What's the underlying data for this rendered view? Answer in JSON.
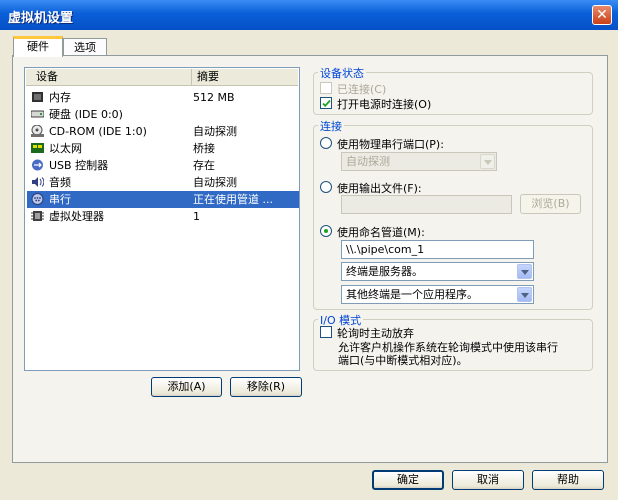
{
  "window": {
    "title": "虚拟机设置",
    "close_glyph": "✕"
  },
  "tabs": [
    {
      "label": "硬件",
      "active": true
    },
    {
      "label": "选项",
      "active": false
    }
  ],
  "device_list": {
    "columns": [
      "设备",
      "摘要"
    ],
    "rows": [
      {
        "device": "内存",
        "summary": "512 MB",
        "icon": "memory-icon"
      },
      {
        "device": "硬盘 (IDE 0:0)",
        "summary": "",
        "icon": "hard-disk-icon"
      },
      {
        "device": "CD-ROM (IDE 1:0)",
        "summary": "自动探测",
        "icon": "cdrom-icon"
      },
      {
        "device": "以太网",
        "summary": "桥接",
        "icon": "ethernet-icon"
      },
      {
        "device": "USB 控制器",
        "summary": "存在",
        "icon": "usb-icon"
      },
      {
        "device": "音频",
        "summary": "自动探测",
        "icon": "audio-icon"
      },
      {
        "device": "串行",
        "summary": "正在使用管道 ...",
        "icon": "serial-port-icon",
        "selected": true
      },
      {
        "device": "虚拟处理器",
        "summary": "1",
        "icon": "processor-icon"
      }
    ]
  },
  "list_buttons": {
    "add": "添加(A)",
    "remove": "移除(R)"
  },
  "device_status": {
    "title": "设备状态",
    "connected": {
      "label": "已连接(C)",
      "checked": false,
      "disabled": true
    },
    "connect_on_power": {
      "label": "打开电源时连接(O)",
      "checked": true
    }
  },
  "connection": {
    "title": "连接",
    "physical": {
      "label": "使用物理串行端口(P):",
      "selected": false,
      "combo_value": "自动探测"
    },
    "output_file": {
      "label": "使用输出文件(F):",
      "selected": false,
      "file_value": "",
      "browse": "浏览(B)"
    },
    "named_pipe": {
      "label": "使用命名管道(M):",
      "selected": true,
      "pipe_value": "\\\\.\\pipe\\com_1",
      "end_value": "终端是服务器。",
      "other_end_value": "其他终端是一个应用程序。"
    }
  },
  "io_mode": {
    "title": "I/O 模式",
    "yield": {
      "label": "轮询时主动放弃",
      "checked": false
    },
    "description": [
      "允许客户机操作系统在轮询模式中使用该串行",
      "端口(与中断模式相对应)。"
    ]
  },
  "footer": {
    "ok": "确定",
    "cancel": "取消",
    "help": "帮助"
  },
  "colors": {
    "titlebar": "#0a5fd8",
    "selection": "#316ac5",
    "group_label": "#0046d5"
  }
}
